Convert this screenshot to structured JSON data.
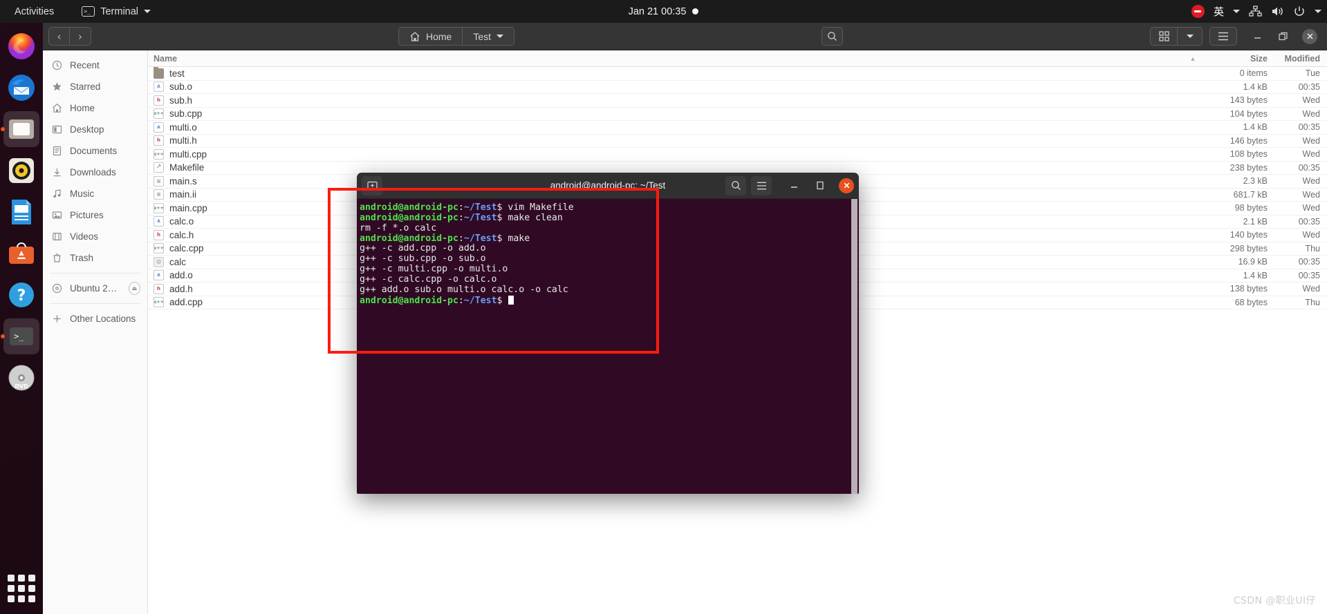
{
  "topbar": {
    "activities": "Activities",
    "app_menu": {
      "label": "Terminal",
      "icon": "terminal-icon",
      "caret": "▾"
    },
    "clock": "Jan 21  00:35",
    "tray": {
      "record_icon": "screen-record-icon",
      "ime": "英",
      "network_icon": "network-wired-icon",
      "volume_icon": "volume-icon",
      "power_icon": "power-icon",
      "caret": "▾"
    }
  },
  "dock": {
    "items": [
      {
        "name": "firefox",
        "label": "Firefox",
        "running": false
      },
      {
        "name": "thunderbird",
        "label": "Thunderbird",
        "running": false
      },
      {
        "name": "files",
        "label": "Files",
        "running": true
      },
      {
        "name": "rhythmbox",
        "label": "Rhythmbox",
        "running": false
      },
      {
        "name": "libreoffice-writer",
        "label": "LibreOffice Writer",
        "running": false
      },
      {
        "name": "ubuntu-software",
        "label": "Ubuntu Software",
        "running": false
      },
      {
        "name": "help",
        "label": "Help",
        "running": false
      },
      {
        "name": "terminal",
        "label": "Terminal",
        "running": true
      },
      {
        "name": "dvd",
        "label": "Ubuntu 20.0...",
        "running": false
      }
    ],
    "show_apps_label": "Show Applications"
  },
  "nautilus": {
    "nav": {
      "back": "‹",
      "forward": "›"
    },
    "pathbar": [
      {
        "label": "Home",
        "icon": "home-icon",
        "caret": ""
      },
      {
        "label": "Test",
        "icon": "",
        "caret": "▾"
      }
    ],
    "search_icon": "search-icon",
    "view_icon": "grid-view-icon",
    "view_caret": "▾",
    "menu_icon": "hamburger-menu-icon",
    "window": {
      "minimize": "—",
      "maximize": "❐",
      "close": "✕"
    },
    "places": [
      {
        "label": "Recent",
        "icon": "clock-icon"
      },
      {
        "label": "Starred",
        "icon": "star-icon"
      },
      {
        "label": "Home",
        "icon": "home-icon"
      },
      {
        "label": "Desktop",
        "icon": "desktop-icon"
      },
      {
        "label": "Documents",
        "icon": "documents-icon"
      },
      {
        "label": "Downloads",
        "icon": "download-icon"
      },
      {
        "label": "Music",
        "icon": "music-icon"
      },
      {
        "label": "Pictures",
        "icon": "pictures-icon"
      },
      {
        "label": "Videos",
        "icon": "videos-icon"
      },
      {
        "label": "Trash",
        "icon": "trash-icon"
      }
    ],
    "devices": [
      {
        "label": "Ubuntu 20.0...",
        "icon": "disc-icon",
        "eject": "⏏"
      }
    ],
    "other": {
      "label": "Other Locations",
      "icon": "plus-icon"
    },
    "columns": {
      "name": "Name",
      "size": "Size",
      "modified": "Modified",
      "sort_arrow": "▲"
    },
    "files": [
      {
        "name": "test",
        "type": "folder",
        "badge": "",
        "size": "0 items",
        "modified": "Tue"
      },
      {
        "name": "sub.o",
        "type": "o",
        "badge": "A",
        "size": "1.4 kB",
        "modified": "00:35"
      },
      {
        "name": "sub.h",
        "type": "h",
        "badge": "h",
        "size": "143 bytes",
        "modified": "Wed"
      },
      {
        "name": "sub.cpp",
        "type": "cpp",
        "badge": "c++",
        "size": "104 bytes",
        "modified": "Wed"
      },
      {
        "name": "multi.o",
        "type": "o",
        "badge": "A",
        "size": "1.4 kB",
        "modified": "00:35"
      },
      {
        "name": "multi.h",
        "type": "h",
        "badge": "h",
        "size": "146 bytes",
        "modified": "Wed"
      },
      {
        "name": "multi.cpp",
        "type": "cpp",
        "badge": "c++",
        "size": "108 bytes",
        "modified": "Wed"
      },
      {
        "name": "Makefile",
        "type": "mk",
        "badge": "↗",
        "size": "238 bytes",
        "modified": "00:35"
      },
      {
        "name": "main.s",
        "type": "txt",
        "badge": "≡",
        "size": "2.3 kB",
        "modified": "Wed"
      },
      {
        "name": "main.ii",
        "type": "txt",
        "badge": "≡",
        "size": "681.7 kB",
        "modified": "Wed"
      },
      {
        "name": "main.cpp",
        "type": "cpp",
        "badge": "c++",
        "size": "98 bytes",
        "modified": "Wed"
      },
      {
        "name": "calc.o",
        "type": "o",
        "badge": "A",
        "size": "2.1 kB",
        "modified": "00:35"
      },
      {
        "name": "calc.h",
        "type": "h",
        "badge": "h",
        "size": "140 bytes",
        "modified": "Wed"
      },
      {
        "name": "calc.cpp",
        "type": "cpp",
        "badge": "c++",
        "size": "298 bytes",
        "modified": "Thu"
      },
      {
        "name": "calc",
        "type": "exe",
        "badge": "⚙",
        "size": "16.9 kB",
        "modified": "00:35"
      },
      {
        "name": "add.o",
        "type": "o",
        "badge": "A",
        "size": "1.4 kB",
        "modified": "00:35"
      },
      {
        "name": "add.h",
        "type": "h",
        "badge": "h",
        "size": "138 bytes",
        "modified": "Wed"
      },
      {
        "name": "add.cpp",
        "type": "cpp",
        "badge": "c++",
        "size": "68 bytes",
        "modified": "Thu"
      }
    ]
  },
  "terminal": {
    "title": "android@android-pc: ~/Test",
    "new_tab_icon": "new-tab-icon",
    "search_icon": "search-icon",
    "menu_icon": "hamburger-menu-icon",
    "window": {
      "minimize": "—",
      "maximize": "❐",
      "close": "✕"
    },
    "prompt": {
      "user": "android@android-pc",
      "colon": ":",
      "path": "~/Test",
      "dollar": "$ "
    },
    "lines": [
      {
        "kind": "prompt",
        "cmd": "vim Makefile"
      },
      {
        "kind": "prompt",
        "cmd": "make clean"
      },
      {
        "kind": "out",
        "text": "rm -f *.o calc"
      },
      {
        "kind": "prompt",
        "cmd": "make"
      },
      {
        "kind": "out",
        "text": "g++ -c add.cpp -o add.o"
      },
      {
        "kind": "out",
        "text": "g++ -c sub.cpp -o sub.o"
      },
      {
        "kind": "out",
        "text": "g++ -c multi.cpp -o multi.o"
      },
      {
        "kind": "out",
        "text": "g++ -c calc.cpp -o calc.o"
      },
      {
        "kind": "out",
        "text": "g++ add.o sub.o multi.o calc.o -o calc"
      },
      {
        "kind": "prompt-cursor",
        "cmd": ""
      }
    ]
  },
  "annotation": {
    "color": "#fc1b10",
    "shape": "rectangle"
  },
  "watermark": "CSDN @职业UI仔"
}
